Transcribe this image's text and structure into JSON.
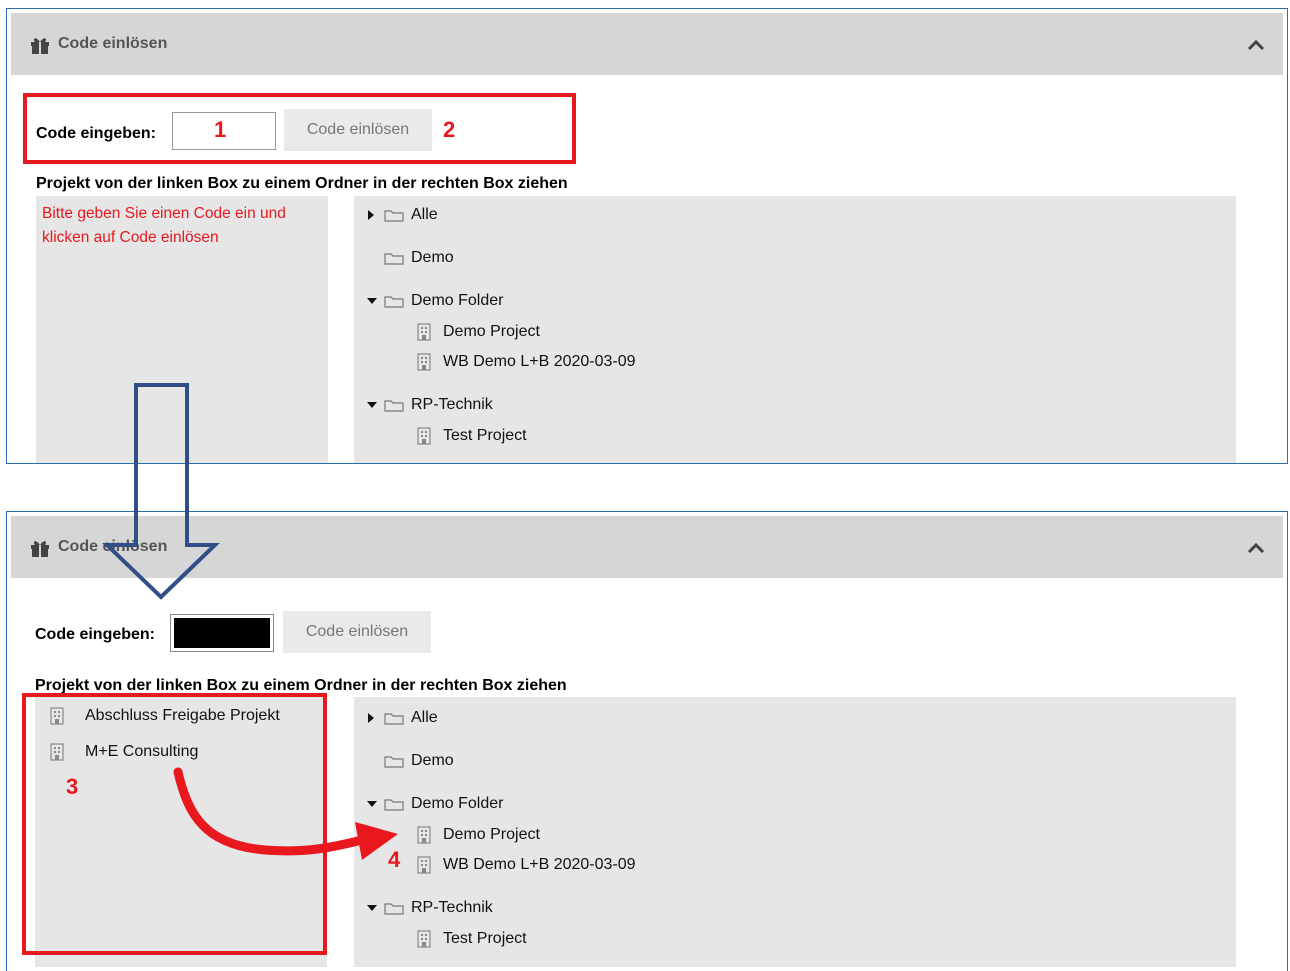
{
  "panels": [
    {
      "header_title": "Code einlösen",
      "code_label": "Code eingeben:",
      "redeem_label": "Code einlösen",
      "instruction": "Projekt von der linken Box zu einem Ordner in der rechten Box ziehen",
      "hint": "Bitte geben Sie einen Code ein und klicken auf Code einlösen",
      "tree": {
        "alle": "Alle",
        "demo": "Demo",
        "demo_folder": "Demo Folder",
        "demo_project": "Demo Project",
        "wb_demo": "WB Demo L+B 2020-03-09",
        "rp_technik": "RP-Technik",
        "test_project": "Test Project"
      }
    },
    {
      "header_title": "Code einlösen",
      "code_label": "Code eingeben:",
      "redeem_label": "Code einlösen",
      "instruction": "Projekt von der linken Box zu einem Ordner in der rechten Box ziehen",
      "projects": [
        "Abschluss Freigabe Projekt",
        "M+E Consulting"
      ],
      "tree": {
        "alle": "Alle",
        "demo": "Demo",
        "demo_folder": "Demo Folder",
        "demo_project": "Demo Project",
        "wb_demo": "WB Demo L+B 2020-03-09",
        "rp_technik": "RP-Technik",
        "test_project": "Test Project"
      }
    }
  ],
  "annotations": {
    "n1": "1",
    "n2": "2",
    "n3": "3",
    "n4": "4"
  },
  "icons": {
    "header": "gift-icon",
    "collapse": "chevron-up-icon",
    "folder": "folder-icon",
    "project": "building-icon",
    "expanded": "caret-down-icon",
    "collapsed": "caret-right-icon"
  },
  "colors": {
    "annotation_red": "#e8181e",
    "panel_border": "#2a6db0",
    "arrow_blue": "#2f4f86",
    "header_bg": "#d6d6d6",
    "box_bg": "#e6e6e6"
  }
}
